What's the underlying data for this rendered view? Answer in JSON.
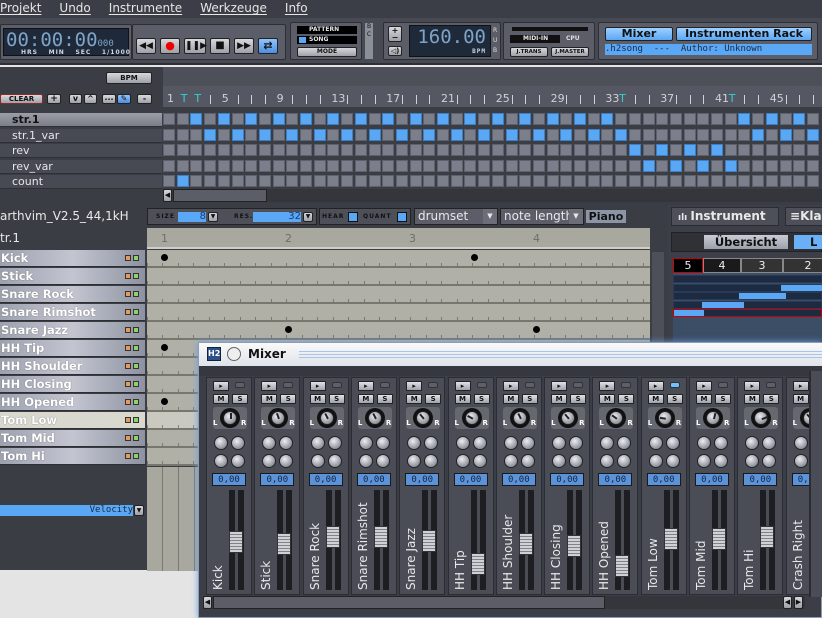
{
  "menu": [
    "Projekt",
    "Undo",
    "Instrumente",
    "Werkzeuge",
    "Info"
  ],
  "transport": {
    "time": "00:00:00",
    "ms": "000",
    "labels": [
      "HRS",
      "MIN",
      "SEC",
      "1/1000"
    ],
    "buttons": [
      "rewind",
      "record",
      "play-pause",
      "stop",
      "fast-forward",
      "loop"
    ],
    "loop_active": true
  },
  "mode": {
    "pattern": "PATTERN",
    "song": "SONG",
    "mode": "MODE",
    "active": "song",
    "bc": "B C"
  },
  "bpm": {
    "value": "160.00",
    "label": "BPM",
    "rub": "R U B"
  },
  "midi": {
    "midi_in": "MIDI-IN",
    "cpu": "CPU",
    "jtrans": "J.TRANS",
    "jmaster": "J.MASTER"
  },
  "info": {
    "mixer": "Mixer",
    "rack": "Instrumenten Rack",
    "song": ".h2song  ---  Author: Unknown"
  },
  "song_editor": {
    "bpm_btn": "BPM",
    "clear": "CLEAR",
    "tools": [
      "+",
      "v",
      "^",
      "...",
      "pencil",
      "-"
    ],
    "ruler": [
      "1",
      "5",
      "9",
      "13",
      "17",
      "21",
      "25",
      "29",
      "33",
      "37",
      "41",
      "45"
    ],
    "tempo_markers": [
      2,
      3,
      34,
      42
    ],
    "columns": 48,
    "patterns": [
      {
        "name": "str.1",
        "selected": true,
        "active": [
          3,
          5,
          7,
          9,
          11,
          13,
          15,
          17,
          19,
          21,
          23,
          25,
          27,
          29,
          31,
          33,
          43,
          45,
          47
        ]
      },
      {
        "name": "str.1_var",
        "active": [
          4,
          6,
          8,
          10,
          12,
          14,
          16,
          18,
          20,
          22,
          24,
          26,
          28,
          30,
          32,
          34,
          44,
          46,
          48
        ]
      },
      {
        "name": "rev",
        "active": [
          35,
          37,
          39,
          41
        ]
      },
      {
        "name": "rev_var",
        "active": [
          36,
          38,
          40,
          42
        ]
      },
      {
        "name": "count",
        "active": [
          2
        ]
      }
    ]
  },
  "pattern_editor": {
    "name": "arthvim_V2.5_44,1kH",
    "size_label": "SIZE",
    "size": "8",
    "res_label": "RES.",
    "res": "32",
    "hear": "HEAR",
    "quant": "QUANT",
    "drumkit": "drumset",
    "note_length": "note length",
    "piano": "Piano",
    "pattern": "tr.1",
    "beats": [
      "1",
      "2",
      "3",
      "4"
    ],
    "velocity": "Velocity",
    "instruments": [
      {
        "name": "Kick",
        "notes": [
          1,
          3.5
        ]
      },
      {
        "name": "Stick",
        "notes": []
      },
      {
        "name": "Snare Rock",
        "notes": []
      },
      {
        "name": "Snare Rimshot",
        "notes": []
      },
      {
        "name": "Snare Jazz",
        "notes": [
          2,
          4
        ]
      },
      {
        "name": "HH Tip",
        "notes": [
          1
        ]
      },
      {
        "name": "HH Shoulder",
        "notes": []
      },
      {
        "name": "HH Closing",
        "notes": []
      },
      {
        "name": "HH Opened",
        "notes": [
          1
        ]
      },
      {
        "name": "Tom Low",
        "notes": [],
        "selected": true
      },
      {
        "name": "Tom Mid",
        "notes": []
      },
      {
        "name": "Tom Hi",
        "notes": []
      }
    ]
  },
  "right_panel": {
    "tab_instrument": "Instrument",
    "tab_other": "Klan",
    "overview": "Übersicht",
    "layers_btn": "L",
    "layers": [
      "5",
      "4",
      "3",
      "2"
    ]
  },
  "mixer": {
    "title": "Mixer",
    "value": "0,00",
    "m": "M",
    "s": "S",
    "l": "L",
    "r": "R",
    "strips": [
      {
        "name": "Kick",
        "fader": 0.55,
        "pan": 0
      },
      {
        "name": "Stick",
        "fader": 0.52,
        "pan": -0.15
      },
      {
        "name": "Snare Rock",
        "fader": 0.6,
        "pan": -0.2
      },
      {
        "name": "Snare Rimshot",
        "fader": 0.6,
        "pan": -0.2
      },
      {
        "name": "Snare Jazz",
        "fader": 0.56,
        "pan": -0.3
      },
      {
        "name": "HH Tip",
        "fader": 0.3,
        "pan": -0.45
      },
      {
        "name": "HH Shoulder",
        "fader": 0.52,
        "pan": -0.2
      },
      {
        "name": "HH Closing",
        "fader": 0.5,
        "pan": -0.3
      },
      {
        "name": "HH Opened",
        "fader": 0.28,
        "pan": -0.4
      },
      {
        "name": "Tom Low",
        "fader": 0.58,
        "pan": -0.6,
        "active": true
      },
      {
        "name": "Tom Mid",
        "fader": 0.58,
        "pan": 0.1
      },
      {
        "name": "Tom Hi",
        "fader": 0.6,
        "pan": 0.5
      },
      {
        "name": "Crash Right",
        "fader": 0.5,
        "pan": -0.3
      }
    ]
  },
  "colors": {
    "accent": "#5aa7f5",
    "background": "#3a3d44",
    "grid": "#b1b0a7"
  }
}
